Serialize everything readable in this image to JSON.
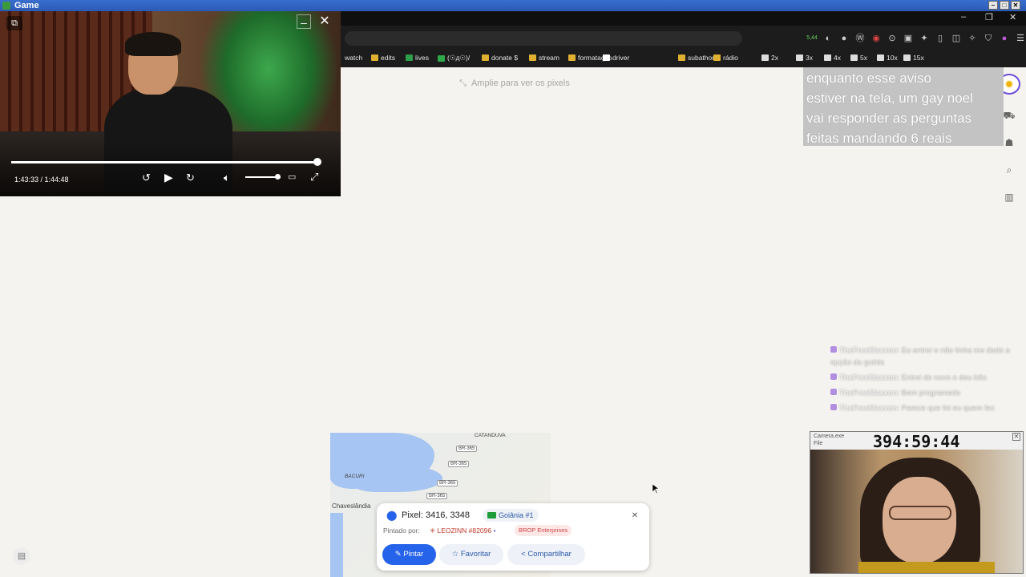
{
  "window": {
    "title": "Game",
    "controls": [
      "–",
      "□",
      "✕"
    ]
  },
  "browser_controls": [
    "–",
    "❐",
    "✕"
  ],
  "bookmarks": [
    {
      "label": "watch",
      "color": "#444"
    },
    {
      "label": "edits",
      "color": "#e0b030"
    },
    {
      "label": "lives",
      "color": "#2e9e48"
    },
    {
      "label": "(☉д☉)/",
      "color": "#2ea84a"
    },
    {
      "label": "donate $",
      "color": "#e0b030"
    },
    {
      "label": "stream",
      "color": "#e0b030"
    },
    {
      "label": "formatação",
      "color": "#e0b030"
    },
    {
      "label": "driver",
      "color": "#ffffff"
    },
    {
      "label": "subathon",
      "color": "#e0b030"
    },
    {
      "label": "rádio",
      "color": "#e0b030"
    },
    {
      "label": "2x",
      "color": "#ddd"
    },
    {
      "label": "3x",
      "color": "#ddd"
    },
    {
      "label": "4x",
      "color": "#ddd"
    },
    {
      "label": "5x",
      "color": "#ddd"
    },
    {
      "label": "10x",
      "color": "#ddd"
    },
    {
      "label": "15x",
      "color": "#ddd"
    }
  ],
  "extension_badge": "5,44",
  "video": {
    "time": "1:43:33 / 1:44:48",
    "progress": 0.99,
    "volume": 0.85
  },
  "zoom_hint": "Amplie para ver os pixels",
  "overlay_text": [
    "enquanto esse aviso",
    "estiver na tela, um gay noel",
    "vai responder as perguntas",
    "feitas mandando 6 reais"
  ],
  "chat": [
    {
      "name": "TheFreeMaxxon",
      "text": ": Eu entrei e não tinha me dado a opção da guilda"
    },
    {
      "name": "TheFreeMaxxon",
      "text": ": Entrei de novo e deu bão"
    },
    {
      "name": "TheFreeMaxxon",
      "text": ": Bem programado"
    },
    {
      "name": "TheFreeMaxxon",
      "text": ": Parece que foi eu quem fez"
    }
  ],
  "webcam": {
    "title": "Camera.exe",
    "menu": "File",
    "timer": "394:59:44"
  },
  "map": {
    "labels": [
      "CATANDUVA",
      "BACURI",
      "Chaveslândia"
    ],
    "roads": [
      "BR-365",
      "BR-365",
      "BR-365",
      "BR-365"
    ]
  },
  "pixel_card": {
    "pixel": "Pixel: 3416, 3348",
    "region": "Goiânia #1",
    "painted_by_label": "Pintado por:",
    "user": "LEOZINN #82096",
    "team": "BROP Enterprises",
    "paint_label": "Pintar",
    "favorite_label": "Favoritar",
    "share_label": "Compartilhar"
  },
  "colors": {
    "accent": "#2563eb",
    "overlay_bg": "#c3c3c3",
    "logo_ring": "#6c4bd6"
  }
}
